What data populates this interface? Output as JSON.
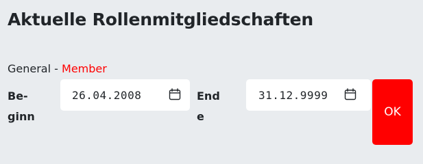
{
  "page": {
    "title": "Aktuelle Rollenmitgliedschaften"
  },
  "membership": {
    "group": "General",
    "separator": " - ",
    "role": "Member"
  },
  "fields": {
    "begin_label": "Be-\nginn",
    "begin_value": "26.04.2008",
    "end_label": "End\ne",
    "end_value": "31.12.9999"
  },
  "actions": {
    "ok_label": "OK"
  },
  "icons": {
    "calendar": "calendar-icon"
  },
  "colors": {
    "accent": "#ff0000",
    "background": "#e9ecef",
    "text": "#212529"
  }
}
